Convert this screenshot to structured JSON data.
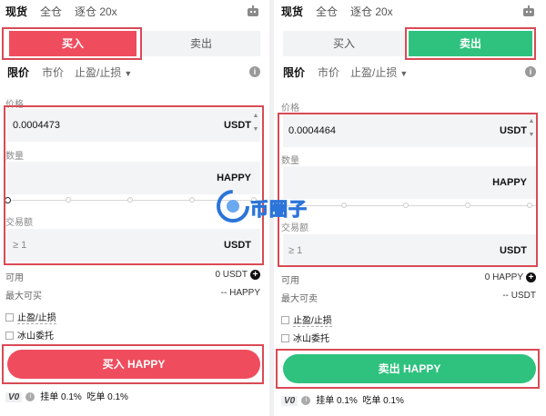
{
  "left": {
    "top_tabs": [
      "现货",
      "全仓",
      "逐仓 20x"
    ],
    "buy_label": "买入",
    "sell_label": "卖出",
    "order_tabs": [
      "限价",
      "市价",
      "止盈/止损"
    ],
    "price_label": "价格",
    "price_value": "0.0004473",
    "price_unit": "USDT",
    "qty_label": "数量",
    "qty_unit": "HAPPY",
    "amount_label": "交易额",
    "amount_placeholder": "≥ 1",
    "amount_unit": "USDT",
    "avail_label": "可用",
    "avail_value": "0 USDT",
    "max_label": "最大可买",
    "max_value": "-- HAPPY",
    "tp_sl_label": "止盈/止损",
    "iceberg_label": "冰山委托",
    "submit_label": "买入 HAPPY",
    "vip_label": "V0",
    "maker_fee": "挂单 0.1%",
    "taker_fee": "吃单 0.1%"
  },
  "right": {
    "top_tabs": [
      "现货",
      "全仓",
      "逐仓 20x"
    ],
    "buy_label": "买入",
    "sell_label": "卖出",
    "order_tabs": [
      "限价",
      "市价",
      "止盈/止损"
    ],
    "price_label": "价格",
    "price_value": "0.0004464",
    "price_unit": "USDT",
    "qty_label": "数量",
    "qty_unit": "HAPPY",
    "amount_label": "交易额",
    "amount_placeholder": "≥ 1",
    "amount_unit": "USDT",
    "avail_label": "可用",
    "avail_value": "0 HAPPY",
    "max_label": "最大可卖",
    "max_value": "-- USDT",
    "tp_sl_label": "止盈/止损",
    "iceberg_label": "冰山委托",
    "submit_label": "卖出 HAPPY",
    "vip_label": "V0",
    "maker_fee": "挂单 0.1%",
    "taker_fee": "吃单 0.1%"
  },
  "watermark": {
    "text": "币圈子"
  },
  "colors": {
    "buy": "#ef4d5e",
    "sell": "#2ec27e",
    "highlight": "#d94a55",
    "field_bg": "#f3f4f6"
  }
}
